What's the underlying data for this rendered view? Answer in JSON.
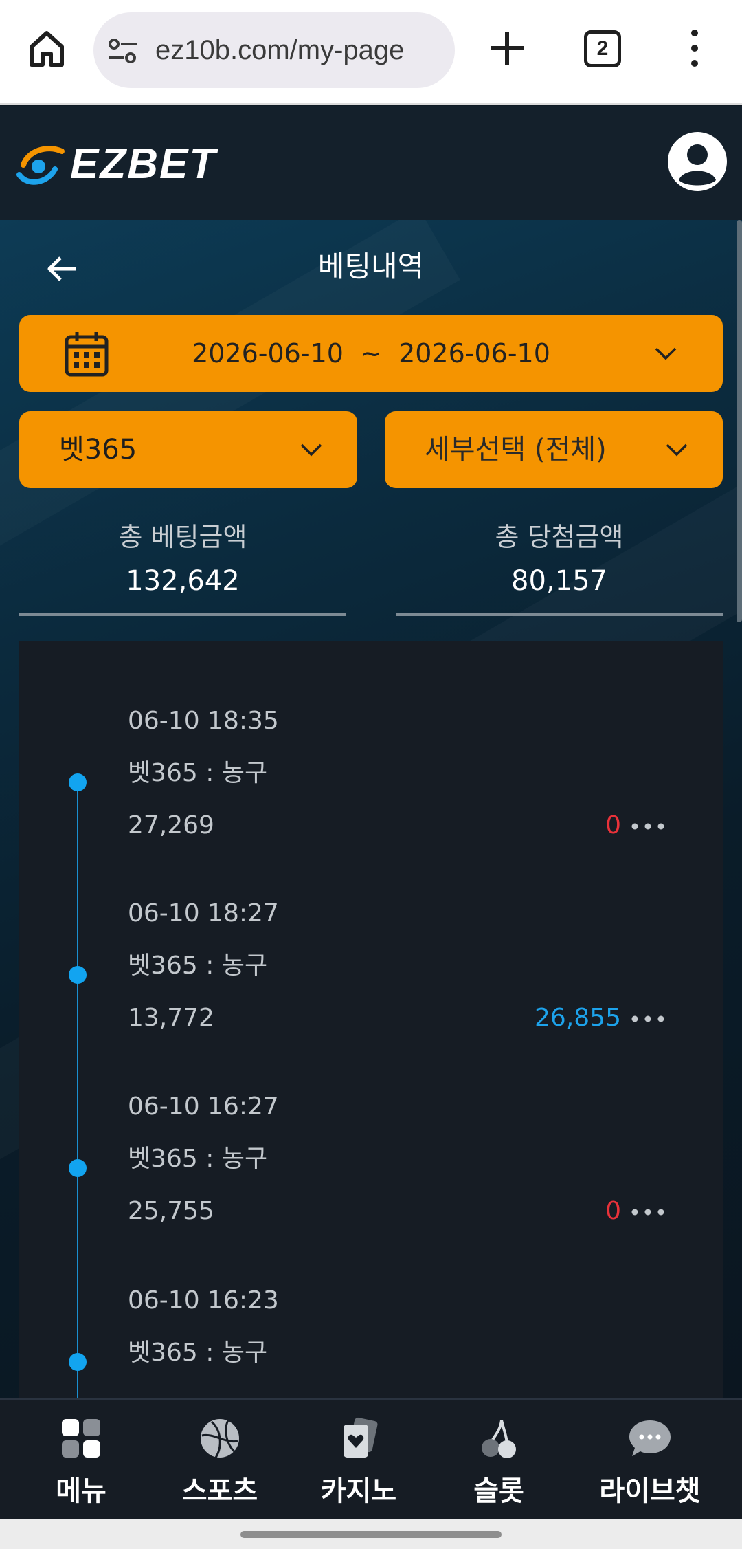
{
  "browser": {
    "url": "ez10b.com/my-page",
    "tab_count": "2"
  },
  "site": {
    "brand": "EZBET"
  },
  "page": {
    "title": "베팅내역",
    "date_range": "2026-06-10  ~  2026-06-10",
    "provider_select": "벳365",
    "detail_select": "세부선택 (전체)",
    "total_bet_label": "총 베팅금액",
    "total_bet_value": "132,642",
    "total_win_label": "총 당첨금액",
    "total_win_value": "80,157"
  },
  "entries": [
    {
      "time": "06-10 18:35",
      "game": "벳365 : 농구",
      "amount": "27,269",
      "result": "0",
      "result_color": "#e9323a"
    },
    {
      "time": "06-10 18:27",
      "game": "벳365 : 농구",
      "amount": "13,772",
      "result": "26,855",
      "result_color": "#1da3ec"
    },
    {
      "time": "06-10 16:27",
      "game": "벳365 : 농구",
      "amount": "25,755",
      "result": "0",
      "result_color": "#e9323a"
    },
    {
      "time": "06-10 16:23",
      "game": "벳365 : 농구",
      "amount": "",
      "result": "",
      "result_color": "#e9323a"
    }
  ],
  "bottom_nav": [
    {
      "label": "메뉴",
      "icon": "menu-grid-icon"
    },
    {
      "label": "스포츠",
      "icon": "basketball-icon"
    },
    {
      "label": "카지노",
      "icon": "cards-icon"
    },
    {
      "label": "슬롯",
      "icon": "cherry-icon"
    },
    {
      "label": "라이브챗",
      "icon": "chat-bubble-icon"
    }
  ],
  "colors": {
    "accent": "#f59400",
    "timeline": "#12a4f0",
    "loss": "#e9323a",
    "win": "#1da3ec"
  }
}
